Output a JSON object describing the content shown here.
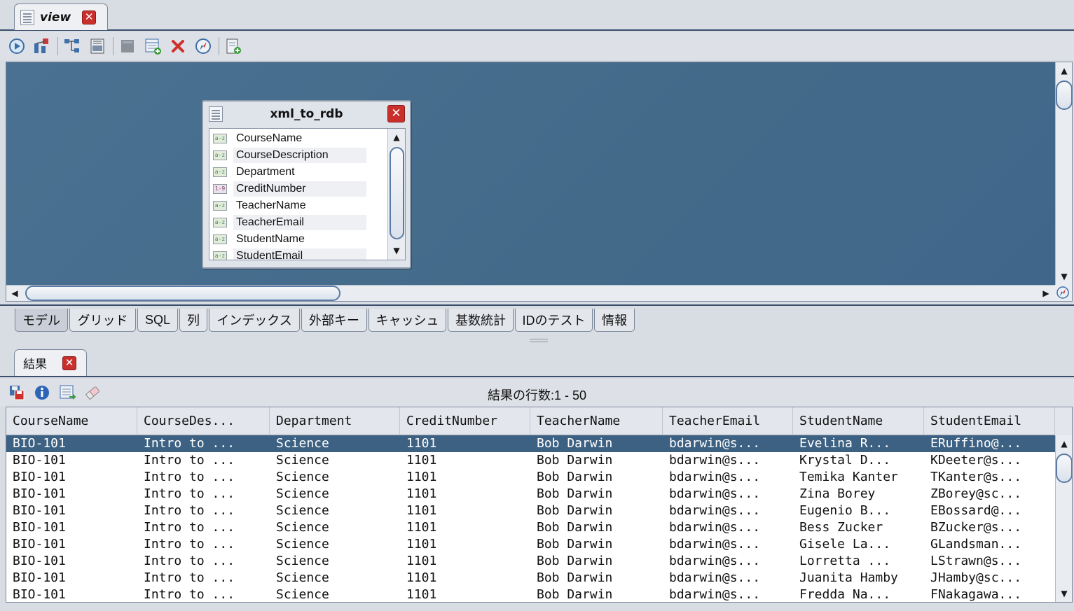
{
  "top_tab": {
    "label": "view"
  },
  "toolbar": {
    "icons": [
      "play-icon",
      "schema-icon",
      "relations-icon",
      "print-icon",
      "disabled-icon",
      "add-table-icon",
      "delete-icon",
      "compass-icon",
      "export-icon"
    ]
  },
  "entity": {
    "title": "xml_to_rdb",
    "columns": [
      {
        "name": "CourseName",
        "type": "a-z"
      },
      {
        "name": "CourseDescription",
        "type": "a-z"
      },
      {
        "name": "Department",
        "type": "a-z"
      },
      {
        "name": "CreditNumber",
        "type": "1-9"
      },
      {
        "name": "TeacherName",
        "type": "a-z"
      },
      {
        "name": "TeacherEmail",
        "type": "a-z"
      },
      {
        "name": "StudentName",
        "type": "a-z"
      },
      {
        "name": "StudentEmail",
        "type": "a-z"
      }
    ]
  },
  "mid_tabs": [
    "モデル",
    "グリッド",
    "SQL",
    "列",
    "インデックス",
    "外部キー",
    "キャッシュ",
    "基数統計",
    "IDのテスト",
    "情報"
  ],
  "results_tab": {
    "label": "結果"
  },
  "results": {
    "row_count_label": "結果の行数:1 - 50",
    "headers": [
      "CourseName",
      "CourseDes...",
      "Department",
      "CreditNumber",
      "TeacherName",
      "TeacherEmail",
      "StudentName",
      "StudentEmail"
    ],
    "rows": [
      [
        "BIO-101",
        "Intro to ...",
        "Science",
        "1101",
        "Bob Darwin",
        "bdarwin@s...",
        "Evelina R...",
        "ERuffino@..."
      ],
      [
        "BIO-101",
        "Intro to ...",
        "Science",
        "1101",
        "Bob Darwin",
        "bdarwin@s...",
        "Krystal D...",
        "KDeeter@s..."
      ],
      [
        "BIO-101",
        "Intro to ...",
        "Science",
        "1101",
        "Bob Darwin",
        "bdarwin@s...",
        "Temika Kanter",
        "TKanter@s..."
      ],
      [
        "BIO-101",
        "Intro to ...",
        "Science",
        "1101",
        "Bob Darwin",
        "bdarwin@s...",
        "Zina Borey",
        "ZBorey@sc..."
      ],
      [
        "BIO-101",
        "Intro to ...",
        "Science",
        "1101",
        "Bob Darwin",
        "bdarwin@s...",
        "Eugenio B...",
        "EBossard@..."
      ],
      [
        "BIO-101",
        "Intro to ...",
        "Science",
        "1101",
        "Bob Darwin",
        "bdarwin@s...",
        "Bess Zucker",
        "BZucker@s..."
      ],
      [
        "BIO-101",
        "Intro to ...",
        "Science",
        "1101",
        "Bob Darwin",
        "bdarwin@s...",
        "Gisele La...",
        "GLandsman..."
      ],
      [
        "BIO-101",
        "Intro to ...",
        "Science",
        "1101",
        "Bob Darwin",
        "bdarwin@s...",
        "Lorretta ...",
        "LStrawn@s..."
      ],
      [
        "BIO-101",
        "Intro to ...",
        "Science",
        "1101",
        "Bob Darwin",
        "bdarwin@s...",
        "Juanita Hamby",
        "JHamby@sc..."
      ],
      [
        "BIO-101",
        "Intro to ...",
        "Science",
        "1101",
        "Bob Darwin",
        "bdarwin@s...",
        "Fredda Na...",
        "FNakagawa..."
      ]
    ]
  },
  "colors": {
    "canvas": "#476d8d",
    "selected_row": "#3d6182",
    "close": "#c9302c"
  }
}
